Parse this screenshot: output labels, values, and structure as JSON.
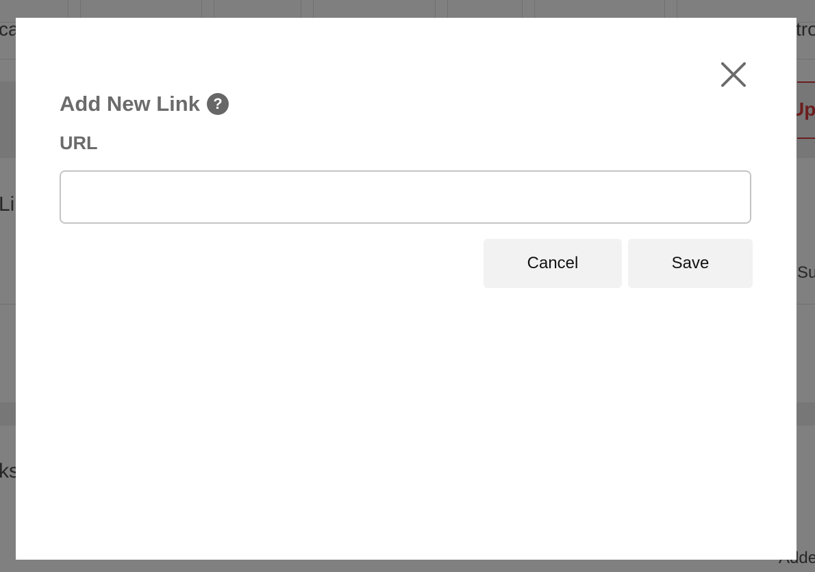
{
  "background": {
    "fragments": {
      "top_left": "ca",
      "top_right": "tro",
      "red_right": "Up",
      "mid_left": "Li",
      "mid_right": "Su",
      "low_left": "ks",
      "bottom_right": "Adde"
    }
  },
  "modal": {
    "title": "Add New Link",
    "help_glyph": "?",
    "url_label": "URL",
    "url_value": "",
    "url_placeholder": "",
    "cancel_label": "Cancel",
    "save_label": "Save",
    "icons": {
      "close": "close-icon",
      "help": "question-circle-icon"
    }
  },
  "colors": {
    "accent_red": "#9b2b2b",
    "title_gray": "#6b6b6b",
    "button_bg": "#f2f2f2",
    "overlay": "#808080"
  }
}
